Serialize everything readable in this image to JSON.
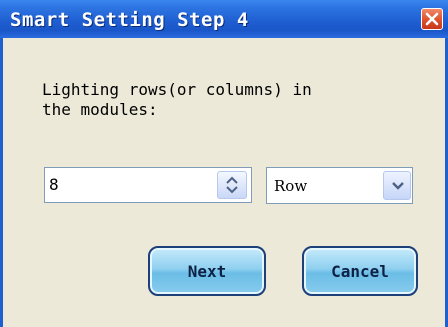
{
  "window": {
    "title": "Smart Setting Step 4",
    "close_icon": "close-icon"
  },
  "prompt": {
    "text": "Lighting rows(or columns) in\nthe modules:"
  },
  "count_spinner": {
    "value": "8",
    "icon": "up-down-arrows-icon"
  },
  "orientation_select": {
    "selected": "Row",
    "icon": "chevron-down-icon"
  },
  "buttons": {
    "next_label": "Next",
    "cancel_label": "Cancel"
  },
  "colors": {
    "titlebar": "#1f5fd2",
    "close": "#e2532f",
    "button_fill": "#8fd0f0",
    "dialog_bg": "#ece9d8"
  }
}
